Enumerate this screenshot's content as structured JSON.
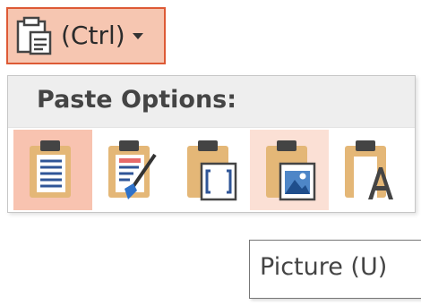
{
  "ctrl_button": {
    "label": "(Ctrl)",
    "icon": "paste-clipboard-icon",
    "arrow_icon": "dropdown-arrow-icon"
  },
  "paste_menu": {
    "title": "Paste Options:",
    "options": [
      {
        "icon": "use-destination-theme-icon",
        "state": "selected"
      },
      {
        "icon": "keep-source-formatting-icon",
        "state": "normal"
      },
      {
        "icon": "embed-icon",
        "state": "normal"
      },
      {
        "icon": "picture-icon",
        "state": "hovered"
      },
      {
        "icon": "keep-text-only-icon",
        "state": "normal"
      }
    ]
  },
  "tooltip": {
    "text": "Picture (U)"
  },
  "colors": {
    "accent_border": "#dd5a35",
    "accent_fill": "#f6c6b1",
    "hover_fill": "#fbe0d5",
    "clipboard_tan": "#e4b777",
    "clipboard_dark": "#444444",
    "lines_blue": "#2f5597"
  }
}
